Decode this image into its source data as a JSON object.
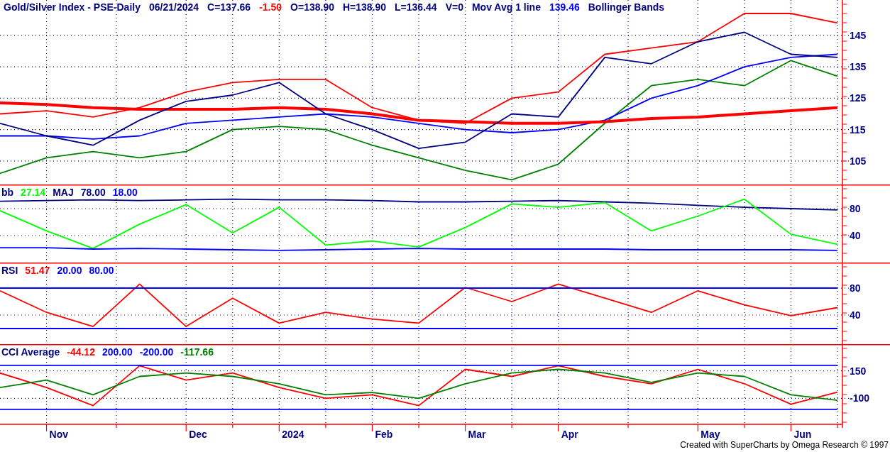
{
  "panels": [
    {
      "legend": [
        {
          "text": "Gold/Silver Index - PSE-Daily",
          "color": "#000080"
        },
        {
          "text": "06/21/2024",
          "color": "#000080"
        },
        {
          "text": "C=137.66",
          "color": "#000080"
        },
        {
          "text": "-1.50",
          "color": "#ff0000"
        },
        {
          "text": "O=138.90",
          "color": "#000080"
        },
        {
          "text": "H=138.90",
          "color": "#000080"
        },
        {
          "text": "L=136.44",
          "color": "#000080"
        },
        {
          "text": "V=0",
          "color": "#000080"
        },
        {
          "text": "Mov Avg 1 line",
          "color": "#000080"
        },
        {
          "text": "139.46",
          "color": "#0000ff"
        },
        {
          "text": "Bollinger Bands",
          "color": "#000080"
        }
      ],
      "chart_data": {
        "type": "line",
        "grid": true,
        "categories": [
          null,
          null,
          null,
          null,
          null,
          null,
          null,
          null,
          null,
          null,
          null,
          null,
          null,
          null,
          null,
          null,
          null,
          null,
          null
        ],
        "ylim": [
          97.5,
          156.3
        ],
        "yticks": [
          {
            "value": 105,
            "label": "105"
          },
          {
            "value": 115,
            "label": "115"
          },
          {
            "value": 125,
            "label": "125"
          },
          {
            "value": 135,
            "label": "135"
          },
          {
            "value": 145,
            "label": "145"
          }
        ],
        "series": [
          {
            "color": "#ff0000",
            "values": [
              120,
              121,
              119,
              122,
              127,
              130,
              131,
              131,
              122,
              118,
              117,
              125,
              127,
              139,
              141,
              143,
              152,
              152,
              149
            ]
          },
          {
            "color": "#008000",
            "values": [
              101,
              106,
              108,
              106,
              108,
              115,
              116,
              115,
              110,
              106,
              102,
              99,
              104,
              117,
              129,
              131,
              129,
              137,
              132
            ]
          },
          {
            "color": "#0000ff",
            "values": [
              113,
              113,
              112,
              113,
              117,
              118,
              119,
              120,
              119,
              117,
              115,
              114,
              115,
              118,
              125,
              129,
              135,
              138,
              139
            ]
          },
          {
            "color": "#ff0000",
            "values": [
              123.5,
              123,
              122,
              121.5,
              121.5,
              121.5,
              122,
              121.5,
              120,
              118,
              117.5,
              117,
              117,
              117.5,
              118.5,
              119,
              120,
              121,
              122
            ]
          },
          {
            "color": "#000080",
            "values": [
              117,
              113,
              110,
              118,
              124,
              126,
              130,
              120,
              115,
              109,
              111,
              120,
              119,
              138,
              136,
              143,
              146,
              139,
              138
            ]
          }
        ]
      }
    },
    {
      "legend": [
        {
          "text": "bb",
          "color": "#000080"
        },
        {
          "text": "27.14",
          "color": "#00ff00"
        },
        {
          "text": "MAJ",
          "color": "#000080"
        },
        {
          "text": "78.00",
          "color": "#000080"
        },
        {
          "text": "18.00",
          "color": "#0000ff"
        }
      ],
      "chart_data": {
        "type": "line",
        "grid": true,
        "categories": [
          null,
          null,
          null,
          null,
          null,
          null,
          null,
          null,
          null,
          null,
          null,
          null,
          null,
          null,
          null,
          null,
          null,
          null,
          null
        ],
        "ylim": [
          0,
          115.8
        ],
        "yticks": [
          {
            "value": 40,
            "label": "40"
          },
          {
            "value": 80,
            "label": "80"
          }
        ],
        "series": [
          {
            "color": "#000080",
            "values": [
              91,
              92,
              93,
              92,
              93,
              94,
              93,
              93,
              92,
              90,
              90,
              91,
              92,
              90,
              88,
              85,
              82,
              80,
              78
            ]
          },
          {
            "color": "#00ff00",
            "values": [
              77,
              47,
              21,
              57,
              86,
              44,
              82,
              26,
              32,
              23,
              52,
              87,
              82,
              89,
              47,
              69,
              94,
              42,
              27
            ]
          },
          {
            "color": "#0000ff",
            "values": [
              22,
              22,
              20,
              21,
              20,
              19,
              18,
              19,
              20,
              21,
              20,
              20,
              20,
              20,
              19,
              19,
              19,
              19,
              18
            ]
          }
        ]
      }
    },
    {
      "legend": [
        {
          "text": "RSI",
          "color": "#000080"
        },
        {
          "text": "51.47",
          "color": "#ff0000"
        },
        {
          "text": "20.00",
          "color": "#0000ff"
        },
        {
          "text": "80.00",
          "color": "#0000ff"
        }
      ],
      "chart_data": {
        "type": "line",
        "grid": true,
        "categories": [
          null,
          null,
          null,
          null,
          null,
          null,
          null,
          null,
          null,
          null,
          null,
          null,
          null,
          null,
          null,
          null,
          null,
          null,
          null
        ],
        "ylim": [
          -3.2,
          117.9
        ],
        "yticks": [
          {
            "value": 40,
            "label": "40"
          },
          {
            "value": 80,
            "label": "80"
          }
        ],
        "series": [
          {
            "color": "#ff0000",
            "values": [
              76,
              44,
              23,
              86,
              23,
              65,
              28,
              44,
              34,
              28,
              81,
              60,
              86,
              65,
              44,
              76,
              55,
              39,
              51
            ]
          },
          {
            "color": "#0000ff",
            "values": [
              20,
              20,
              20,
              20,
              20,
              20,
              20,
              20,
              20,
              20,
              20,
              20,
              20,
              20,
              20,
              20,
              20,
              20,
              20
            ]
          },
          {
            "color": "#0000ff",
            "values": [
              80,
              80,
              80,
              80,
              80,
              80,
              80,
              80,
              80,
              80,
              80,
              80,
              80,
              80,
              80,
              80,
              80,
              80,
              80
            ]
          }
        ]
      }
    },
    {
      "legend": [
        {
          "text": "CCI Average",
          "color": "#000080"
        },
        {
          "text": "-44.12",
          "color": "#ff0000"
        },
        {
          "text": "200.00",
          "color": "#0000ff"
        },
        {
          "text": "-200.00",
          "color": "#0000ff"
        },
        {
          "text": "-117.66",
          "color": "#008000"
        }
      ],
      "chart_data": {
        "type": "line",
        "grid": true,
        "categories": [
          null,
          "Nov",
          null,
          null,
          "Dec",
          null,
          "2024",
          null,
          "Feb",
          null,
          "Mar",
          null,
          "Apr",
          null,
          null,
          "May",
          null,
          "Jun",
          null
        ],
        "ylim": [
          -330,
          393
        ],
        "yticks": [
          {
            "value": -100,
            "label": "-100"
          },
          {
            "value": 150,
            "label": "150"
          }
        ],
        "series": [
          {
            "color": "#ff0000",
            "values": [
              130,
              -2,
              -166,
              197,
              66,
              130,
              -2,
              -100,
              -67,
              -166,
              164,
              99,
              197,
              99,
              33,
              164,
              33,
              -153,
              -44
            ]
          },
          {
            "color": "#008000",
            "values": [
              -2,
              66,
              -67,
              99,
              130,
              99,
              33,
              -67,
              -47,
              -100,
              33,
              130,
              164,
              130,
              46,
              130,
              99,
              -67,
              -118
            ]
          },
          {
            "color": "#0000ff",
            "values": [
              200,
              200,
              200,
              200,
              200,
              200,
              200,
              200,
              200,
              200,
              200,
              200,
              200,
              200,
              200,
              200,
              200,
              200,
              200
            ]
          },
          {
            "color": "#0000ff",
            "values": [
              -200,
              -200,
              -200,
              -200,
              -200,
              -200,
              -200,
              -200,
              -200,
              -200,
              -200,
              -200,
              -200,
              -200,
              -200,
              -200,
              -200,
              -200,
              -200
            ]
          }
        ]
      }
    }
  ],
  "footer": "Created with SuperCharts by Omega Research © 1997"
}
